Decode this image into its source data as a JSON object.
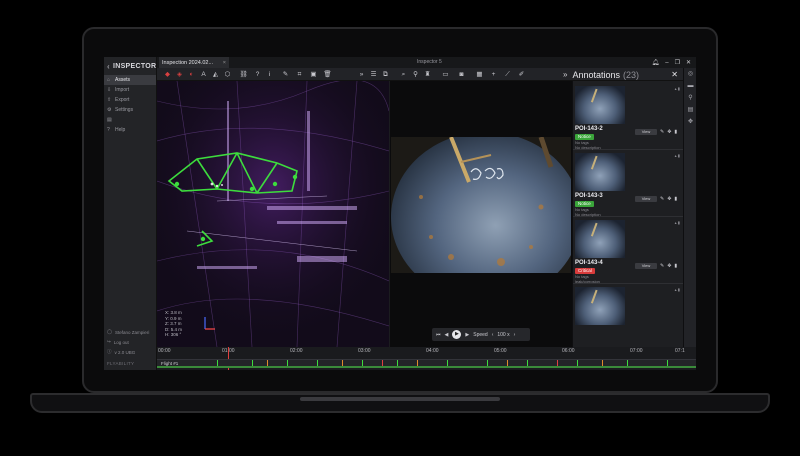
{
  "sidebar": {
    "brand": "INSPECTOR",
    "items": [
      {
        "label": "Assets",
        "icon": "home-icon"
      },
      {
        "label": "Import",
        "icon": "import-icon"
      },
      {
        "label": "Export",
        "icon": "export-icon"
      },
      {
        "label": "Settings",
        "icon": "gear-icon"
      },
      {
        "label": "",
        "icon": "library-icon"
      },
      {
        "label": "Help",
        "icon": "help-icon"
      }
    ],
    "user": "Stefano Zampieri",
    "logout": "Log out",
    "version": "v 2.0 UBG",
    "logo": "FLYABILITY"
  },
  "titlebar": {
    "tab_title": "Inspection 2024.02...",
    "window_title": "Inspector 5"
  },
  "viewport": {
    "coords": [
      "X: 3.8 m",
      "Y: 0.9 m",
      "Z: 3.7 m",
      "D: 5.4 m",
      "H: 306 °"
    ]
  },
  "player": {
    "speed_label": "Speed",
    "speed_value": "100 x"
  },
  "annotations": {
    "title": "Annotations",
    "count": "(23)",
    "cards": [
      {
        "label": "POI-143-2",
        "severity": "Notice",
        "sev_class": "ok",
        "tags": "No tags",
        "description": "No description"
      },
      {
        "label": "POI-143-3",
        "severity": "Notice",
        "sev_class": "ok",
        "tags": "No tags",
        "description": "No description"
      },
      {
        "label": "POI-143-4",
        "severity": "Critical",
        "sev_class": "bad",
        "tags": "No tags",
        "description": "leak/corrosion"
      },
      {
        "label": "",
        "severity": "",
        "sev_class": "",
        "tags": "",
        "description": ""
      }
    ],
    "view_label": "View"
  },
  "timeline": {
    "ticks": [
      "00:00",
      "01:00",
      "02:00",
      "03:00",
      "04:00",
      "05:00",
      "06:00",
      "07:00",
      "07:1"
    ],
    "track_label": "Flight #1"
  },
  "colors": {
    "accent_purple": "#9b3dd6",
    "annotation_green": "#3ddc3d",
    "notice": "#3aa53a",
    "critical": "#d83b3b"
  }
}
